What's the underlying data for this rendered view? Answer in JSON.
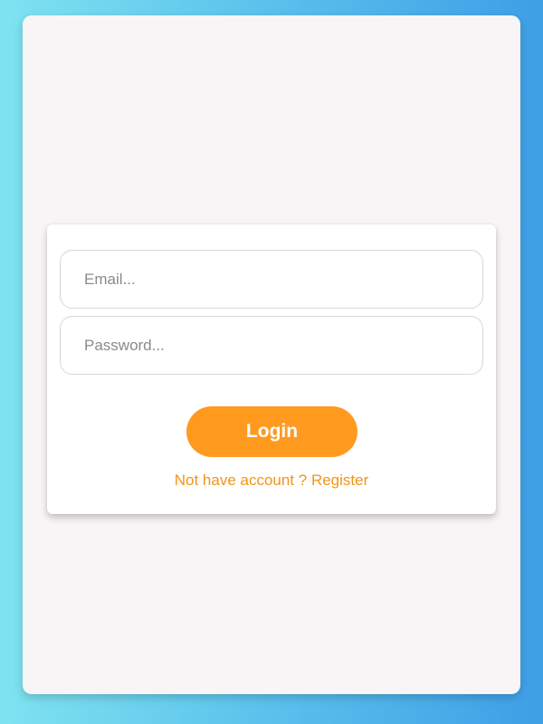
{
  "login_form": {
    "email_placeholder": "Email...",
    "password_placeholder": "Password...",
    "login_label": "Login",
    "register_link_text": "Not have account ? Register"
  },
  "colors": {
    "accent": "#ff9a1f",
    "link": "#f29417",
    "panel_background": "#f7f5f6",
    "gradient_start": "#7fe3f0",
    "gradient_end": "#3e9fe6"
  }
}
